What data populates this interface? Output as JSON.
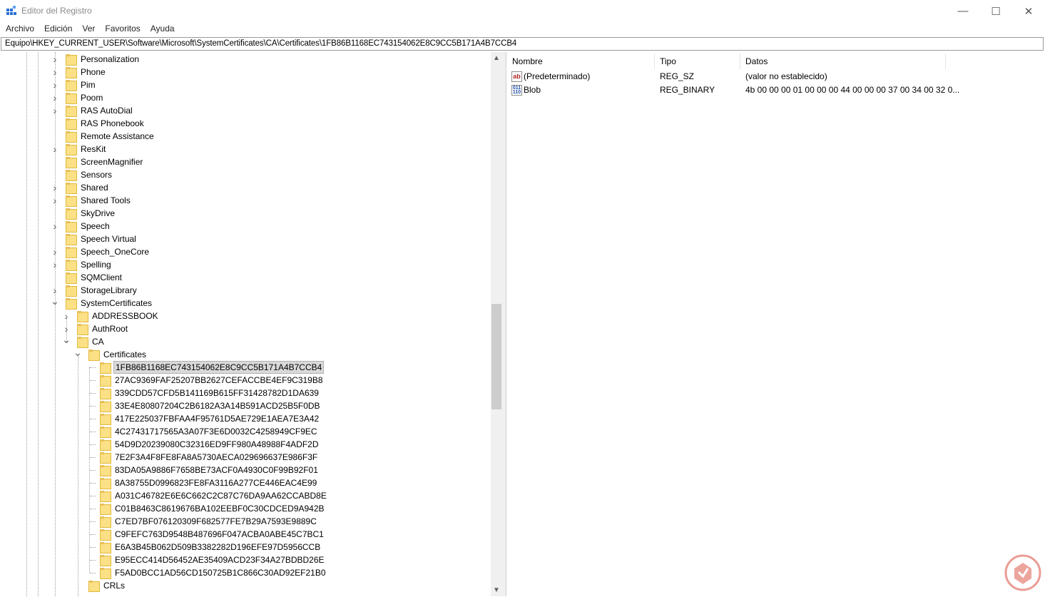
{
  "window": {
    "title": "Editor del Registro",
    "icon": "regedit-icon",
    "controls": {
      "minimize": "—",
      "maximize": "☐",
      "close": "✕"
    }
  },
  "menu": [
    "Archivo",
    "Edición",
    "Ver",
    "Favoritos",
    "Ayuda"
  ],
  "address": "Equipo\\HKEY_CURRENT_USER\\Software\\Microsoft\\SystemCertificates\\CA\\Certificates\\1FB86B1168EC743154062E8C9CC5B171A4B7CCB4",
  "tree": {
    "items": [
      {
        "label": "Personalization",
        "level": 0,
        "expander": "collapsed"
      },
      {
        "label": "Phone",
        "level": 0,
        "expander": "collapsed"
      },
      {
        "label": "Pim",
        "level": 0,
        "expander": "collapsed"
      },
      {
        "label": "Poom",
        "level": 0,
        "expander": "collapsed"
      },
      {
        "label": "RAS AutoDial",
        "level": 0,
        "expander": "collapsed"
      },
      {
        "label": "RAS Phonebook",
        "level": 0,
        "expander": "none"
      },
      {
        "label": "Remote Assistance",
        "level": 0,
        "expander": "none"
      },
      {
        "label": "ResKit",
        "level": 0,
        "expander": "collapsed"
      },
      {
        "label": "ScreenMagnifier",
        "level": 0,
        "expander": "none"
      },
      {
        "label": "Sensors",
        "level": 0,
        "expander": "none"
      },
      {
        "label": "Shared",
        "level": 0,
        "expander": "collapsed"
      },
      {
        "label": "Shared Tools",
        "level": 0,
        "expander": "collapsed"
      },
      {
        "label": "SkyDrive",
        "level": 0,
        "expander": "none"
      },
      {
        "label": "Speech",
        "level": 0,
        "expander": "collapsed"
      },
      {
        "label": "Speech Virtual",
        "level": 0,
        "expander": "none"
      },
      {
        "label": "Speech_OneCore",
        "level": 0,
        "expander": "collapsed"
      },
      {
        "label": "Spelling",
        "level": 0,
        "expander": "collapsed"
      },
      {
        "label": "SQMClient",
        "level": 0,
        "expander": "none"
      },
      {
        "label": "StorageLibrary",
        "level": 0,
        "expander": "collapsed"
      },
      {
        "label": "SystemCertificates",
        "level": 0,
        "expander": "expanded"
      },
      {
        "label": "ADDRESSBOOK",
        "level": 1,
        "expander": "collapsed"
      },
      {
        "label": "AuthRoot",
        "level": 1,
        "expander": "collapsed"
      },
      {
        "label": "CA",
        "level": 1,
        "expander": "expanded"
      },
      {
        "label": "Certificates",
        "level": 2,
        "expander": "expanded"
      },
      {
        "label": "1FB86B1168EC743154062E8C9CC5B171A4B7CCB4",
        "level": 3,
        "expander": "none",
        "selected": true
      },
      {
        "label": "27AC9369FAF25207BB2627CEFACCBE4EF9C319B8",
        "level": 3,
        "expander": "none"
      },
      {
        "label": "339CDD57CFD5B141169B615FF31428782D1DA639",
        "level": 3,
        "expander": "none"
      },
      {
        "label": "33E4E80807204C2B6182A3A14B591ACD25B5F0DB",
        "level": 3,
        "expander": "none"
      },
      {
        "label": "417E225037FBFAA4F95761D5AE729E1AEA7E3A42",
        "level": 3,
        "expander": "none"
      },
      {
        "label": "4C27431717565A3A07F3E6D0032C4258949CF9EC",
        "level": 3,
        "expander": "none"
      },
      {
        "label": "54D9D20239080C32316ED9FF980A48988F4ADF2D",
        "level": 3,
        "expander": "none"
      },
      {
        "label": "7E2F3A4F8FE8FA8A5730AECA029696637E986F3F",
        "level": 3,
        "expander": "none"
      },
      {
        "label": "83DA05A9886F7658BE73ACF0A4930C0F99B92F01",
        "level": 3,
        "expander": "none"
      },
      {
        "label": "8A38755D0996823FE8FA3116A277CE446EAC4E99",
        "level": 3,
        "expander": "none"
      },
      {
        "label": "A031C46782E6E6C662C2C87C76DA9AA62CCABD8E",
        "level": 3,
        "expander": "none"
      },
      {
        "label": "C01B8463C8619676BA102EEBF0C30CDCED9A942B",
        "level": 3,
        "expander": "none"
      },
      {
        "label": "C7ED7BF076120309F682577FE7B29A7593E9889C",
        "level": 3,
        "expander": "none"
      },
      {
        "label": "C9FEFC763D9548B487696F047ACBA0ABE45C7BC1",
        "level": 3,
        "expander": "none"
      },
      {
        "label": "E6A3B45B062D509B3382282D196EFE97D5956CCB",
        "level": 3,
        "expander": "none"
      },
      {
        "label": "E95ECC414D56452AE35409ACD23F34A27BDBD26E",
        "level": 3,
        "expander": "none"
      },
      {
        "label": "F5AD0BCC1AD56CD150725B1C866C30AD92EF21B0",
        "level": 3,
        "expander": "none"
      },
      {
        "label": "CRLs",
        "level": 2,
        "expander": "none"
      }
    ],
    "scroll_arrows": {
      "up": "▲",
      "down": "▼"
    }
  },
  "values_list": {
    "columns": [
      "Nombre",
      "Tipo",
      "Datos"
    ],
    "rows": [
      {
        "icon": "string-value-icon",
        "icon_text": "ab",
        "name": "(Predeterminado)",
        "type": "REG_SZ",
        "data": "(valor no establecido)"
      },
      {
        "icon": "binary-value-icon",
        "icon_text": "011 110",
        "name": "Blob",
        "type": "REG_BINARY",
        "data": "4b 00 00 00 01 00 00 00 44 00 00 00 37 00 34 00 32 0..."
      }
    ]
  },
  "colors": {
    "folder_fill": "#fbe085",
    "selection": "#d9d9d9",
    "watermark": "#d94b3c"
  }
}
